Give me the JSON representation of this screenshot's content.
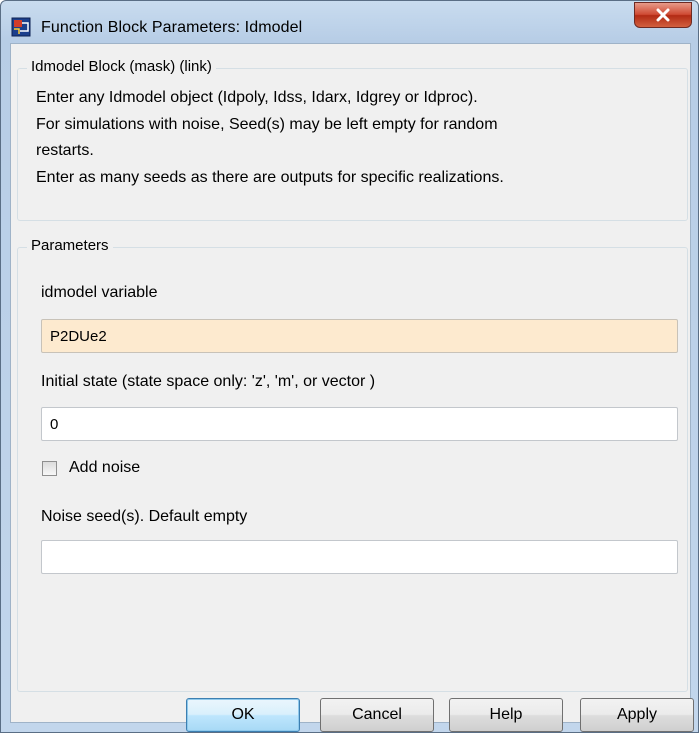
{
  "window": {
    "title": "Function Block Parameters: Idmodel",
    "close_glyph": "X"
  },
  "description": {
    "legend": "Idmodel Block (mask) (link)",
    "lines": [
      "Enter any Idmodel object (Idpoly, Idss, Idarx, Idgrey or Idproc).",
      "For simulations  with noise, Seed(s) may be left empty for random",
      "restarts.",
      "Enter as many seeds as there are outputs for specific realizations."
    ]
  },
  "parameters": {
    "legend": "Parameters",
    "idmodel_label": "idmodel variable",
    "idmodel_value": "P2DUe2",
    "initial_state_label": "Initial state (state space only: 'z', 'm', or vector )",
    "initial_state_value": "0",
    "add_noise_label": "Add noise",
    "add_noise_checked": false,
    "noise_seed_label": "Noise seed(s).  Default empty",
    "noise_seed_value": ""
  },
  "buttons": {
    "ok": "OK",
    "cancel": "Cancel",
    "help": "Help",
    "apply": "Apply"
  },
  "icons": {
    "app": "simulink-block-icon",
    "close": "close-icon"
  },
  "colors": {
    "titlebar": "#b9cfe7",
    "close_button": "#c8442c",
    "active_field": "#fdeacf",
    "dialog_bg": "#f0f0f0"
  }
}
